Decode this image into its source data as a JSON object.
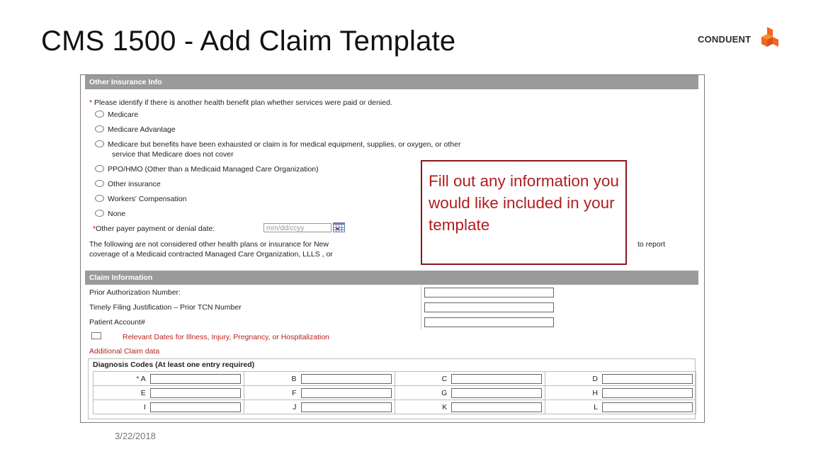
{
  "slide": {
    "title": "CMS 1500 - Add Claim Template",
    "date": "3/22/2018",
    "logo_text": "CONDUENT",
    "logo_color": "#f26522"
  },
  "other_insurance": {
    "header": "Other Insurance Info",
    "required_marker": "*",
    "prompt": "Please identify if there is another health benefit plan whether services were paid or denied.",
    "options": [
      "Medicare",
      "Medicare Advantage",
      "Medicare but benefits have been exhausted or claim is for medical equipment, supplies, or oxygen, or other",
      "PPO/HMO (Other than a Medicaid Managed Care Organization)",
      "Other insurance",
      "Workers' Compensation",
      "None"
    ],
    "option_continuation": "service that Medicare does not cover",
    "payer_date_label": "Other payer payment or denial date:",
    "payer_date_placeholder": "mm/dd/ccyy",
    "note_line1_start": "The following are not considered other health plans or insurance for New",
    "note_line1_end": "to report",
    "note_line2": "coverage of a Medicaid contracted Managed Care Organization, LLLS , or"
  },
  "claim_info": {
    "header": "Claim Information",
    "fields": [
      {
        "label": "Prior Authorization Number:"
      },
      {
        "label": "Timely Filing Justification – Prior TCN Number"
      },
      {
        "label": "Patient Account#"
      }
    ],
    "relevant_dates_label": "Relevant Dates for Illness, Injury, Pregnancy, or Hospitalization",
    "additional_label": "Additional Claim data"
  },
  "diagnosis": {
    "title": "Diagnosis Codes (At least one entry required)",
    "required_marker": "*",
    "rows": [
      [
        "A",
        "B",
        "C",
        "D"
      ],
      [
        "E",
        "F",
        "G",
        "H"
      ],
      [
        "I",
        "J",
        "K",
        "L"
      ]
    ]
  },
  "callout": {
    "text": "Fill out any information you would like included in your template",
    "border_color": "#8b1a1a",
    "text_color": "#b11d1d"
  }
}
